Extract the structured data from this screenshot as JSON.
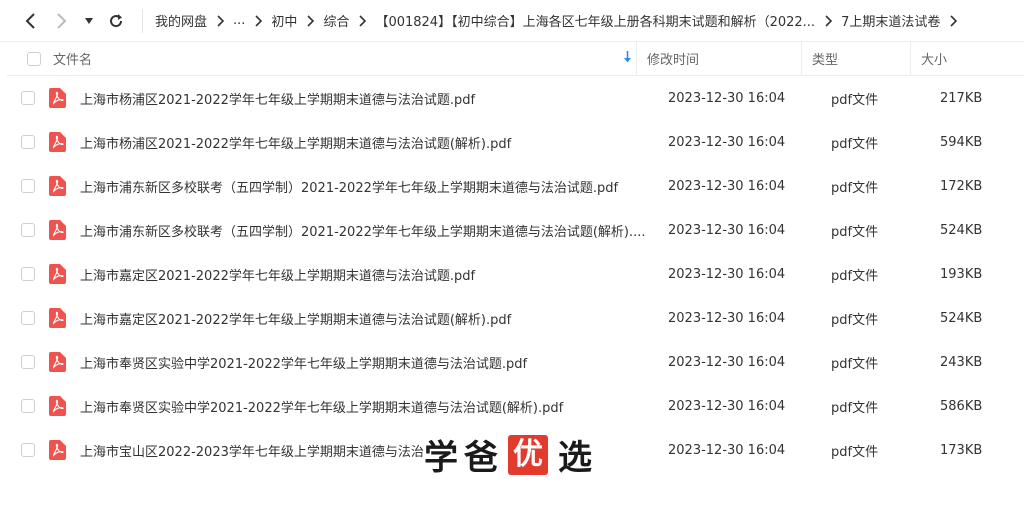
{
  "toolbar": {
    "breadcrumbs": [
      "我的网盘",
      "...",
      "初中",
      "综合",
      "【001824】【初中综合】上海各区七年级上册各科期末试题和解析（2022...",
      "7上期末道法试卷"
    ]
  },
  "columns": {
    "name": "文件名",
    "modified": "修改时间",
    "type": "类型",
    "size": "大小"
  },
  "files": [
    {
      "name": "上海市杨浦区2021-2022学年七年级上学期期末道德与法治试题.pdf",
      "modified": "2023-12-30 16:04",
      "type": "pdf文件",
      "size": "217KB"
    },
    {
      "name": "上海市杨浦区2021-2022学年七年级上学期期末道德与法治试题(解析).pdf",
      "modified": "2023-12-30 16:04",
      "type": "pdf文件",
      "size": "594KB"
    },
    {
      "name": "上海市浦东新区多校联考（五四学制）2021-2022学年七年级上学期期末道德与法治试题.pdf",
      "modified": "2023-12-30 16:04",
      "type": "pdf文件",
      "size": "172KB"
    },
    {
      "name": "上海市浦东新区多校联考（五四学制）2021-2022学年七年级上学期期末道德与法治试题(解析)....",
      "modified": "2023-12-30 16:04",
      "type": "pdf文件",
      "size": "524KB"
    },
    {
      "name": "上海市嘉定区2021-2022学年七年级上学期期末道德与法治试题.pdf",
      "modified": "2023-12-30 16:04",
      "type": "pdf文件",
      "size": "193KB"
    },
    {
      "name": "上海市嘉定区2021-2022学年七年级上学期期末道德与法治试题(解析).pdf",
      "modified": "2023-12-30 16:04",
      "type": "pdf文件",
      "size": "524KB"
    },
    {
      "name": "上海市奉贤区实验中学2021-2022学年七年级上学期期末道德与法治试题.pdf",
      "modified": "2023-12-30 16:04",
      "type": "pdf文件",
      "size": "243KB"
    },
    {
      "name": "上海市奉贤区实验中学2021-2022学年七年级上学期期末道德与法治试题(解析).pdf",
      "modified": "2023-12-30 16:04",
      "type": "pdf文件",
      "size": "586KB"
    },
    {
      "name": "上海市宝山区2022-2023学年七年级上学期期末道德与法治",
      "modified": "2023-12-30 16:04",
      "type": "pdf文件",
      "size": "173KB"
    }
  ],
  "watermark": {
    "text_left": "学爸",
    "seal": "优",
    "text_right": "选"
  },
  "colors": {
    "pdf_icon": "#ef5350",
    "sort_arrow": "#2b8cf2",
    "seal": "#e23b2e"
  }
}
